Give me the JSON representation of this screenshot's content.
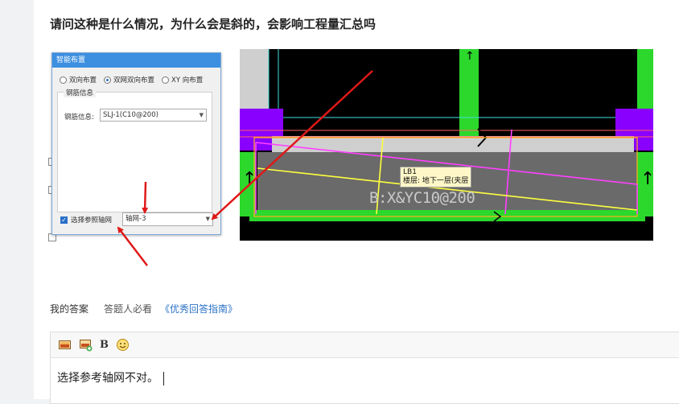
{
  "question": {
    "title": "请问这种是什么情况，为什么会是斜的，会影响工程量汇总吗"
  },
  "dialog": {
    "title": "智能布置",
    "radio_options": [
      "双向布置",
      "双网双向布置",
      "XY 向布置"
    ],
    "selected_radio": "双网双向布置",
    "group_caption": "钢筋信息",
    "rebar_label": "钢筋信息:",
    "rebar_value": "SLJ-1(C10@200)",
    "ref_axis_label": "选择参照轴网",
    "ref_axis_checked": true,
    "ref_axis_value": "轴网-3"
  },
  "cad": {
    "slab_name": "LB1",
    "slab_floor": "楼层: 地下一层(夹层",
    "rebar_text": "B:X&YC10@200",
    "colors": {
      "column_green": "#2bd82b",
      "beam_gray": "#cfcfcf",
      "purple": "#8a00ff",
      "slab_gray": "#6a6a6a",
      "magenta": "#ff40ff",
      "yellow": "#ffff40",
      "red_line": "#ff6060",
      "cyan": "#40e0e0"
    }
  },
  "annotations": {
    "arrow_color": "#e01818"
  },
  "answer_tabs": {
    "my_answer": "我的答案",
    "must_read": "答题人必看",
    "guide_link": "《优秀回答指南》"
  },
  "editor": {
    "toolbar": [
      "image-icon",
      "image-upload-icon",
      "bold",
      "emoji-icon"
    ],
    "bold_label": "B",
    "content": "选择参考轴网不对。"
  }
}
